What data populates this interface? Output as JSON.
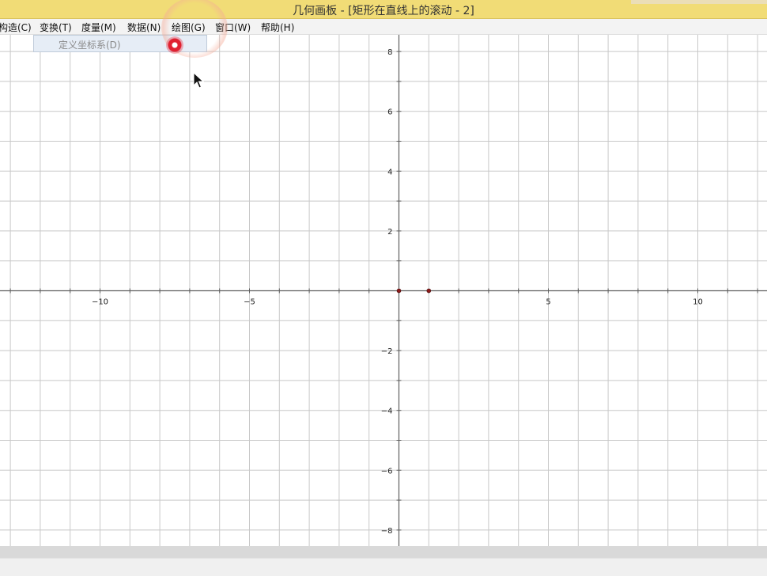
{
  "window": {
    "title": "几何画板 - [矩形在直线上的滚动 - 2]"
  },
  "menubar": {
    "items": [
      {
        "id": "construct",
        "label": "构造(C)"
      },
      {
        "id": "transform",
        "label": "变换(T)"
      },
      {
        "id": "measure",
        "label": "度量(M)"
      },
      {
        "id": "data",
        "label": "数据(N)"
      },
      {
        "id": "graph",
        "label": "绘图(G)"
      },
      {
        "id": "window",
        "label": "窗口(W)"
      },
      {
        "id": "help",
        "label": "帮助(H)"
      }
    ]
  },
  "dropdown": {
    "items": [
      {
        "label": "定义坐标系(D)",
        "enabled": false
      }
    ]
  },
  "graph": {
    "x_ticks": [
      {
        "value": -10,
        "label": "−10"
      },
      {
        "value": -5,
        "label": "−5"
      },
      {
        "value": 5,
        "label": "5"
      },
      {
        "value": 10,
        "label": "10"
      }
    ],
    "y_ticks": [
      {
        "value": 8,
        "label": "8"
      },
      {
        "value": 6,
        "label": "6"
      },
      {
        "value": 4,
        "label": "4"
      },
      {
        "value": 2,
        "label": "2"
      },
      {
        "value": -2,
        "label": "−2"
      },
      {
        "value": -4,
        "label": "−4"
      },
      {
        "value": -6,
        "label": "−6"
      },
      {
        "value": -8,
        "label": "−8"
      }
    ],
    "points": [
      {
        "x": 0,
        "y": 0,
        "name": "origin-point"
      },
      {
        "x": 1,
        "y": 0,
        "name": "unit-point"
      }
    ],
    "grid_color": "#c8c8c8",
    "axis_color": "#606060",
    "point_color": "#8b1a1a"
  }
}
